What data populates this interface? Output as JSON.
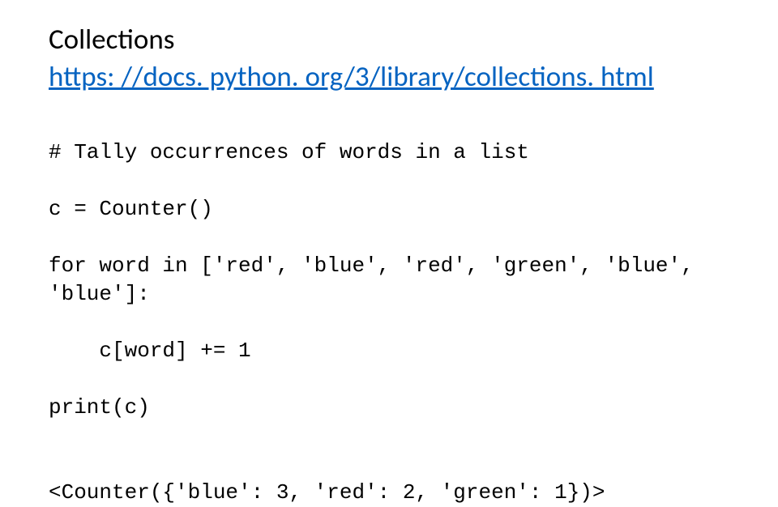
{
  "heading": {
    "title": "Collections",
    "link_text": "https: //docs. python. org/3/library/collections. html",
    "link_href": "https://docs.python.org/3/library/collections.html"
  },
  "code": {
    "lines": [
      "# Tally occurrences of words in a list",
      "c = Counter()",
      "for word in ['red', 'blue', 'red', 'green', 'blue', 'blue']:",
      "    c[word] += 1",
      "print(c)"
    ],
    "output": "<Counter({'blue': 3, 'red': 2, 'green': 1})>"
  }
}
